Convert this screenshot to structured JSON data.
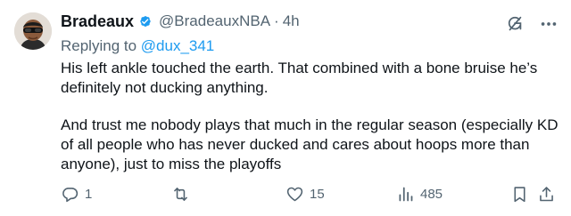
{
  "tweet": {
    "author": {
      "name": "Bradeaux",
      "handle": "@BradeauxNBA",
      "verified": true
    },
    "separator": "·",
    "time": "4h",
    "replying_to_prefix": "Replying to ",
    "replying_to_handle": "@dux_341",
    "paragraphs": [
      "His left ankle touched the earth. That combined with a bone bruise he’s definitely not ducking anything.",
      "And trust me nobody plays that much in the regular season (especially KD of all people who has never ducked and cares about hoops more than anyone), just to miss the playoffs"
    ],
    "stats": {
      "replies": "1",
      "reposts": "",
      "likes": "15",
      "views": "485"
    }
  },
  "colors": {
    "text": "#0f1419",
    "secondary": "#536471",
    "accent": "#1d9bf0"
  },
  "icons": {
    "verified": "verified-badge-icon",
    "grok": "grok-icon",
    "more": "more-icon",
    "reply": "reply-icon",
    "repost": "repost-icon",
    "like": "like-icon",
    "views": "views-icon",
    "bookmark": "bookmark-icon",
    "share": "share-icon"
  }
}
